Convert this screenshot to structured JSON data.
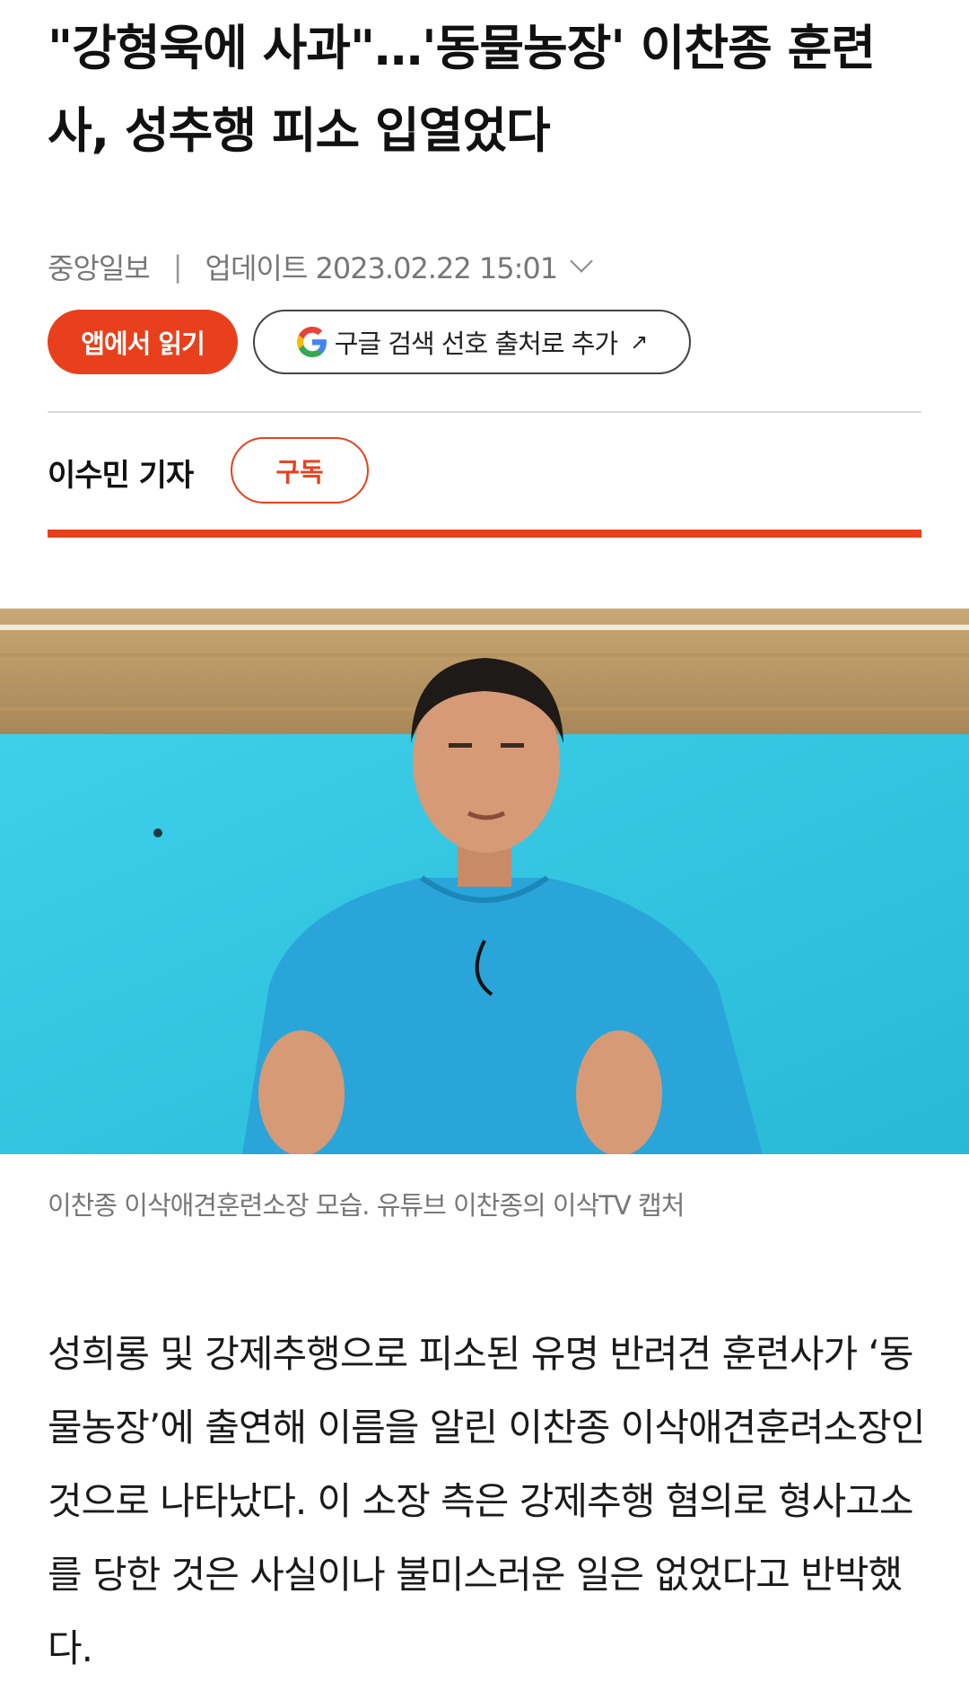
{
  "article": {
    "headline": "\"강형욱에 사과\"…'동물농장' 이찬종 훈련사, 성추행 피소 입열었다",
    "source": "중앙일보",
    "separator": "|",
    "updated": "업데이트 2023.02.22 15:01",
    "reporter": "이수민 기자",
    "photo_caption": "이찬종 이삭애견훈련소장 모습. 유튜브 이찬종의 이삭TV 캡처",
    "body": "성희롱 및 강제추행으로 피소된 유명 반려견 훈련사가 ‘동물농장’에 출연해 이름을 알린 이찬종 이삭애견훈려소장인 것으로 나타났다. 이 소장 측은 강제추행 혐의로 형사고소를 당한 것은 사실이나 불미스러운 일은 없었다고 반박했다."
  },
  "actions": {
    "read_in_app": "앱에서 읽기",
    "google_source": "구글 검색 선호 출처로 추가",
    "google_arrow": "↗",
    "subscribe": "구독"
  },
  "colors": {
    "accent": "#e8401c",
    "photo_wall": "#33c6e0",
    "sweater": "#2aa5d9"
  },
  "icons": {
    "google": "google-g-icon",
    "expand": "chevron-down-icon",
    "external": "external-arrow-icon"
  }
}
